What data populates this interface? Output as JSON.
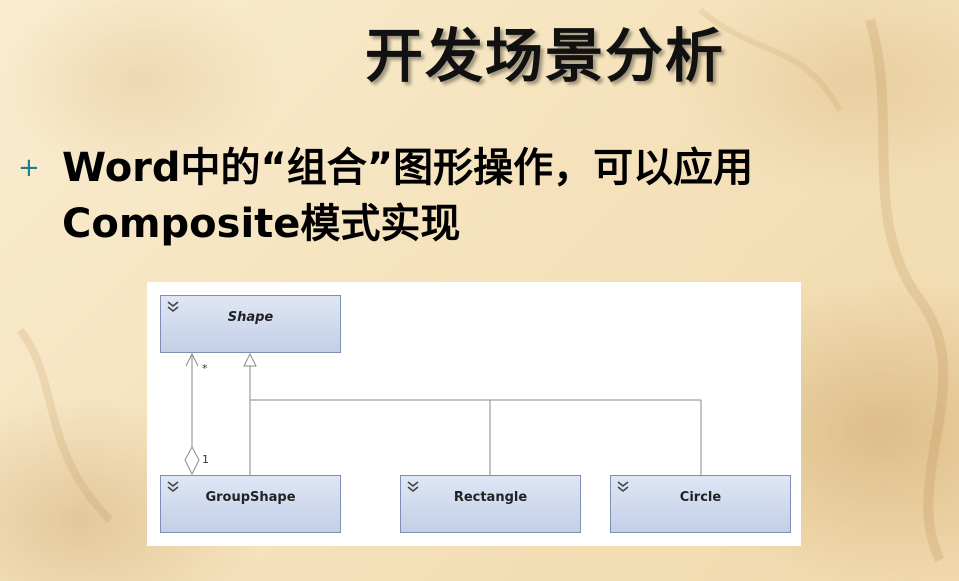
{
  "slide": {
    "title": "开发场景分析",
    "bullet": {
      "marker": "+",
      "text": "Word中的“组合”图形操作，可以应用Composite模式实现"
    }
  },
  "diagram": {
    "classes": [
      {
        "id": "shape",
        "name": "Shape",
        "abstract": true
      },
      {
        "id": "groupshape",
        "name": "GroupShape",
        "abstract": false
      },
      {
        "id": "rectangle",
        "name": "Rectangle",
        "abstract": false
      },
      {
        "id": "circle",
        "name": "Circle",
        "abstract": false
      }
    ],
    "relations": [
      {
        "type": "inheritance",
        "from": "groupshape",
        "to": "shape"
      },
      {
        "type": "inheritance",
        "from": "rectangle",
        "to": "shape"
      },
      {
        "type": "inheritance",
        "from": "circle",
        "to": "shape"
      },
      {
        "type": "aggregation",
        "whole": "groupshape",
        "part": "shape",
        "whole_multiplicity": "1",
        "part_multiplicity": "*"
      }
    ],
    "colors": {
      "class_fill_top": "#dfe7f5",
      "class_fill_bottom": "#c3cfe7",
      "class_border": "#7e8fb3",
      "line": "#8a8a8a"
    }
  }
}
